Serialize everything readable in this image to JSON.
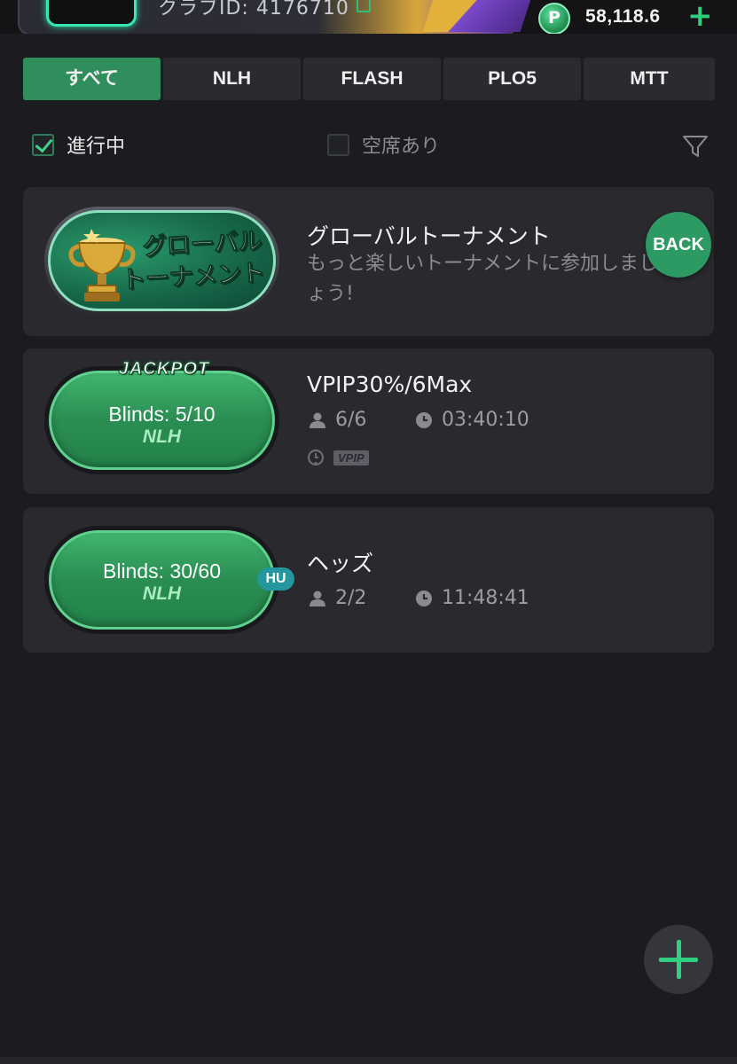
{
  "header": {
    "club_id_text": "クラブID: 4176710",
    "points_icon_letter": "P",
    "points_value": "58,118.6",
    "add_symbol": "+"
  },
  "tabs": [
    {
      "label": "すべて",
      "active": true
    },
    {
      "label": "NLH",
      "active": false
    },
    {
      "label": "FLASH",
      "active": false
    },
    {
      "label": "PLO5",
      "active": false
    },
    {
      "label": "MTT",
      "active": false
    }
  ],
  "filters": {
    "in_progress": {
      "label": "進行中",
      "checked": true
    },
    "seats_available": {
      "label": "空席あり",
      "checked": false
    }
  },
  "tournament_card": {
    "badge_line1": "グローバル",
    "badge_line2": "トーナメント",
    "title": "グローバルトーナメント",
    "description": "もっと楽しいトーナメントに参加しましょう!",
    "back_label": "BACK"
  },
  "tables": [
    {
      "banner": "JACKPOT",
      "blinds": "Blinds: 5/10",
      "game": "NLH",
      "name": "VPIP30%/6Max",
      "players": "6/6",
      "time": "03:40:10",
      "tag": "VPIP"
    },
    {
      "badge": "HU",
      "blinds": "Blinds: 30/60",
      "game": "NLH",
      "name": "ヘッズ",
      "players": "2/2",
      "time": "11:48:41"
    }
  ],
  "colors": {
    "accent_green": "#2f8e5b",
    "background": "#1c1c20",
    "card": "#29292e"
  }
}
